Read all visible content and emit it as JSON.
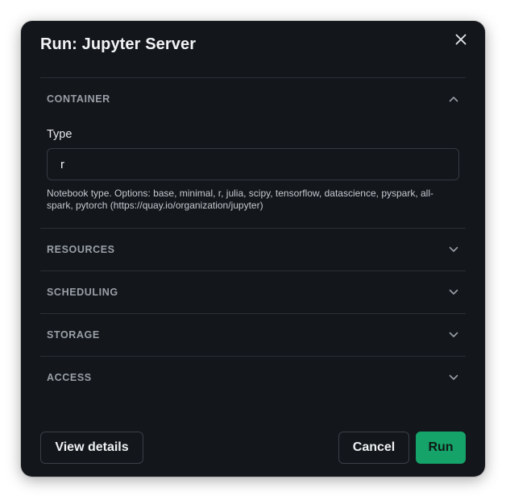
{
  "dialog": {
    "title": "Run: Jupyter Server",
    "close_icon": "close-icon"
  },
  "sections": [
    {
      "label": "CONTAINER",
      "expanded": true,
      "chevron": "chevron-up-icon",
      "field": {
        "label": "Type",
        "value": "r",
        "help": "Notebook type. Options: base, minimal, r, julia, scipy, tensorflow, datascience, pyspark, all-spark, pytorch (https://quay.io/organization/jupyter)"
      }
    },
    {
      "label": "RESOURCES",
      "expanded": false,
      "chevron": "chevron-down-icon"
    },
    {
      "label": "SCHEDULING",
      "expanded": false,
      "chevron": "chevron-down-icon"
    },
    {
      "label": "STORAGE",
      "expanded": false,
      "chevron": "chevron-down-icon"
    },
    {
      "label": "ACCESS",
      "expanded": false,
      "chevron": "chevron-down-icon"
    }
  ],
  "footer": {
    "view_details_label": "View details",
    "cancel_label": "Cancel",
    "run_label": "Run"
  },
  "colors": {
    "dialog_bg": "#13161b",
    "accent": "#16a36a",
    "divider": "#2b2f36"
  }
}
